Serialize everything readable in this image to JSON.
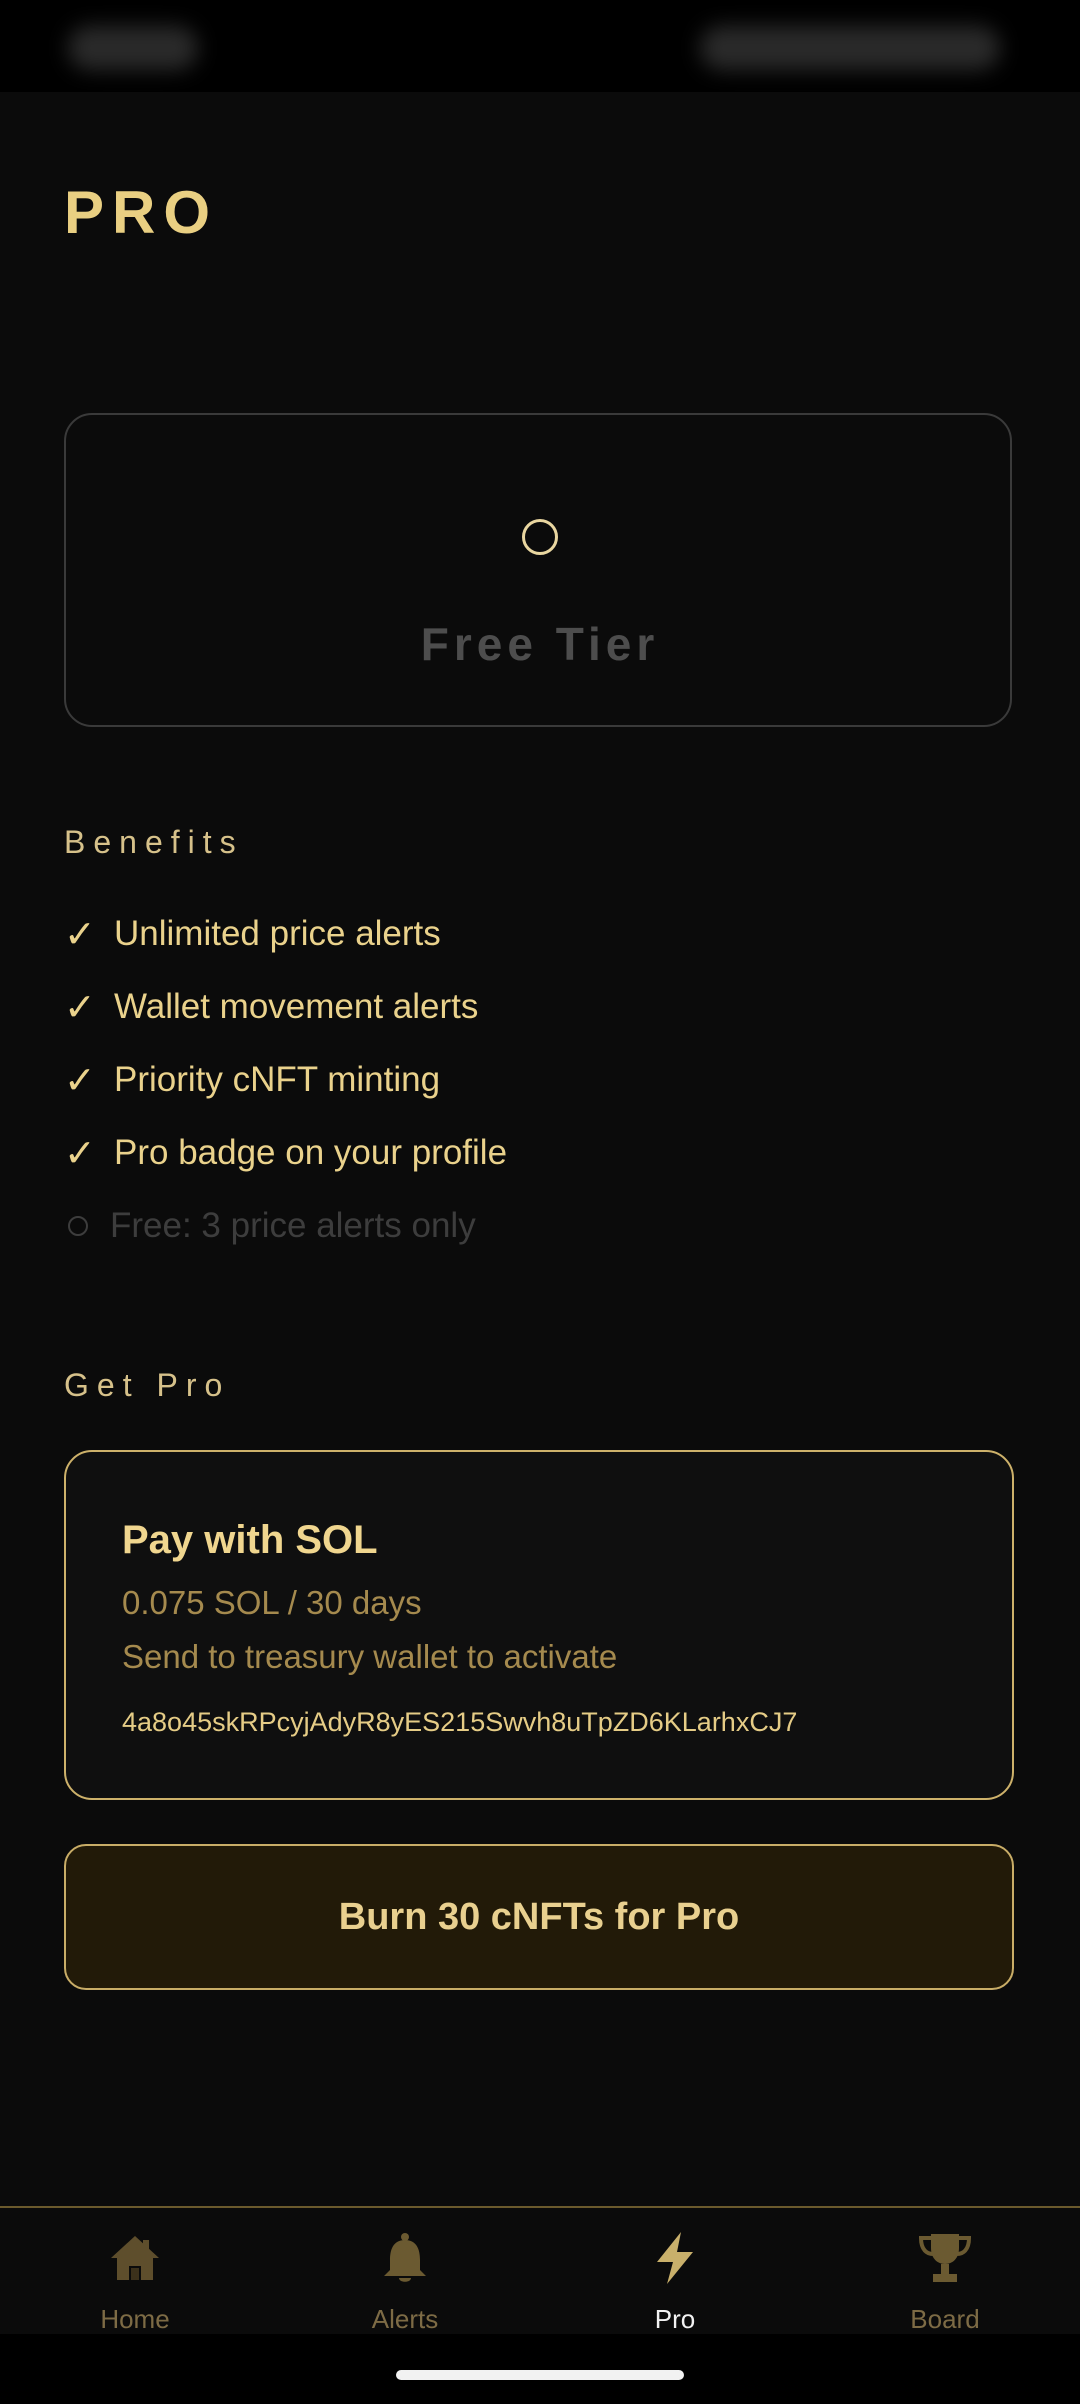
{
  "page": {
    "title": "PRO"
  },
  "tier": {
    "label": "Free Tier"
  },
  "benefits": {
    "heading": "Benefits",
    "items": [
      "Unlimited price alerts",
      "Wallet movement alerts",
      "Priority cNFT minting",
      "Pro badge on your profile"
    ],
    "free_note": "Free: 3 price alerts only"
  },
  "get_pro": {
    "heading": "Get Pro",
    "sol_card": {
      "title": "Pay with SOL",
      "price": "0.075 SOL / 30 days",
      "description": "Send to treasury wallet to activate",
      "wallet": "4a8o45skRPcyjAdyR8yES215Swvh8uTpZD6KLarhxCJ7"
    },
    "burn_button": "Burn 30 cNFTs for Pro"
  },
  "nav": {
    "items": [
      {
        "label": "Home",
        "icon": "home-icon",
        "active": false
      },
      {
        "label": "Alerts",
        "icon": "bell-icon",
        "active": false
      },
      {
        "label": "Pro",
        "icon": "lightning-icon",
        "active": true
      },
      {
        "label": "Board",
        "icon": "trophy-icon",
        "active": false
      }
    ]
  },
  "colors": {
    "accent": "#e9cf82",
    "background": "#0b0b0b",
    "button_fill": "#221a08",
    "muted_text": "#a58a4e",
    "disabled_text": "#4d4d4d"
  }
}
